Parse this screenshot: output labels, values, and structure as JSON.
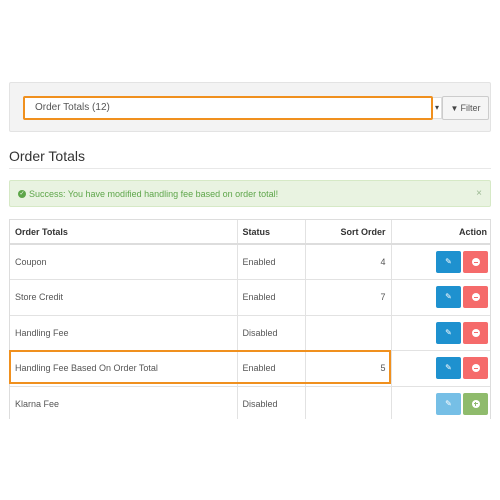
{
  "filter": {
    "selected": "Order Totals (12)",
    "button_label": "Filter"
  },
  "page_title": "Order Totals",
  "alert": {
    "message": "Success: You have modified handling fee based on order total!",
    "close": "×"
  },
  "table": {
    "headers": {
      "name": "Order Totals",
      "status": "Status",
      "sort_order": "Sort Order",
      "action": "Action"
    },
    "rows": [
      {
        "name": "Coupon",
        "status": "Enabled",
        "sort_order": "4",
        "installed": true
      },
      {
        "name": "Store Credit",
        "status": "Enabled",
        "sort_order": "7",
        "installed": true
      },
      {
        "name": "Handling Fee",
        "status": "Disabled",
        "sort_order": "",
        "installed": true
      },
      {
        "name": "Handling Fee Based On Order Total",
        "status": "Enabled",
        "sort_order": "5",
        "installed": true
      },
      {
        "name": "Klarna Fee",
        "status": "Disabled",
        "sort_order": "",
        "installed": false
      }
    ]
  },
  "colors": {
    "highlight": "#f0901e",
    "edit": "#1e91cf",
    "delete": "#f56b6b",
    "install": "#8fbb6c",
    "success_bg": "#e9f3e1"
  },
  "icons": {
    "edit": "pencil-icon",
    "delete": "minus-circle-icon",
    "install": "plus-circle-icon",
    "filter": "filter-icon",
    "alert": "check-circle-icon"
  }
}
